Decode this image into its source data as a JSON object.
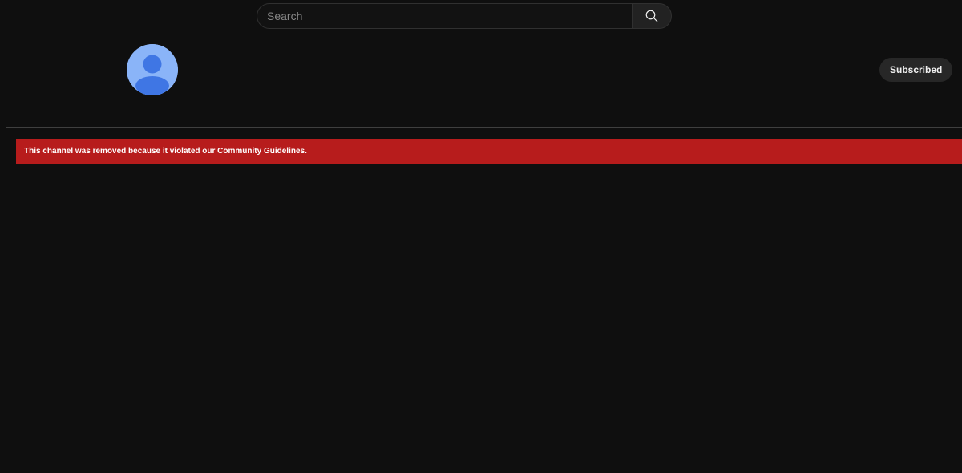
{
  "header": {
    "search": {
      "placeholder": "Search",
      "value": "",
      "button_icon": "search-icon"
    }
  },
  "channel": {
    "avatar_icon": "default-user-avatar-icon",
    "subscribe_button": {
      "label": "Subscribed"
    }
  },
  "banner": {
    "message": "This channel was removed because it violated our Community Guidelines."
  },
  "colors": {
    "background": "#0f0f0f",
    "banner": "#b71c1c",
    "avatar_bg": "#8ab4f8",
    "avatar_fg": "#3f76e4",
    "button_bg": "#272727"
  }
}
